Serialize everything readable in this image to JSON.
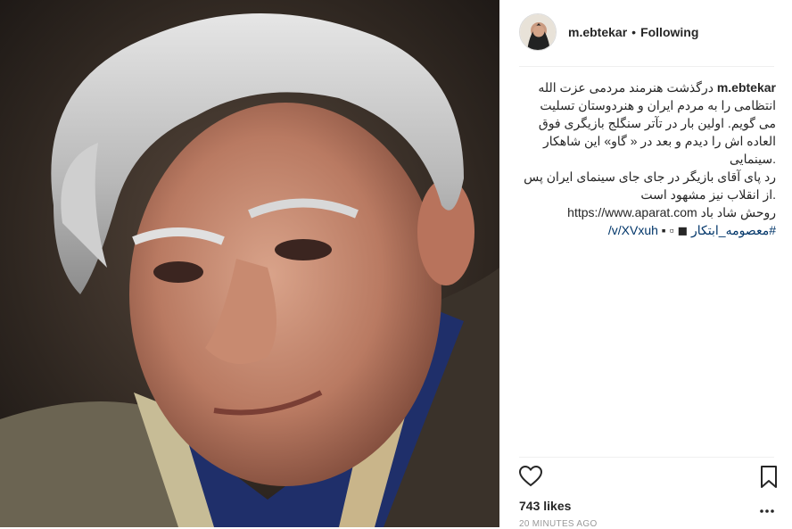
{
  "post": {
    "username": "m.ebtekar",
    "follow_status": "Following",
    "caption_lines": [
      "درگذشت هنرمند مردمی عزت الله",
      "انتظامی را به مردم ایران و هنردوستان تسلیت",
      "می گویم. اولین بار در تآتر سنگلج بازیگری فوق",
      "العاده اش را دیدم و بعد در « گاو» این شاهکار",
      ".سینمایی",
      "رد پای آقای بازیگر در جای جای سینمای ایران پس",
      ".از انقلاب نیز مشهود است",
      "روحش شاد باد"
    ],
    "link_url": "https://www.aparat.com",
    "link_path": "/v/XVxuh",
    "link_icons": "▪ ▫ ◼",
    "hashtag": "#معصومه_ابتکار",
    "likes": "743 likes",
    "timestamp": "20 MINUTES AGO"
  },
  "icons": {
    "like": "heart-icon",
    "save": "bookmark-icon",
    "more": "more-options-icon"
  }
}
